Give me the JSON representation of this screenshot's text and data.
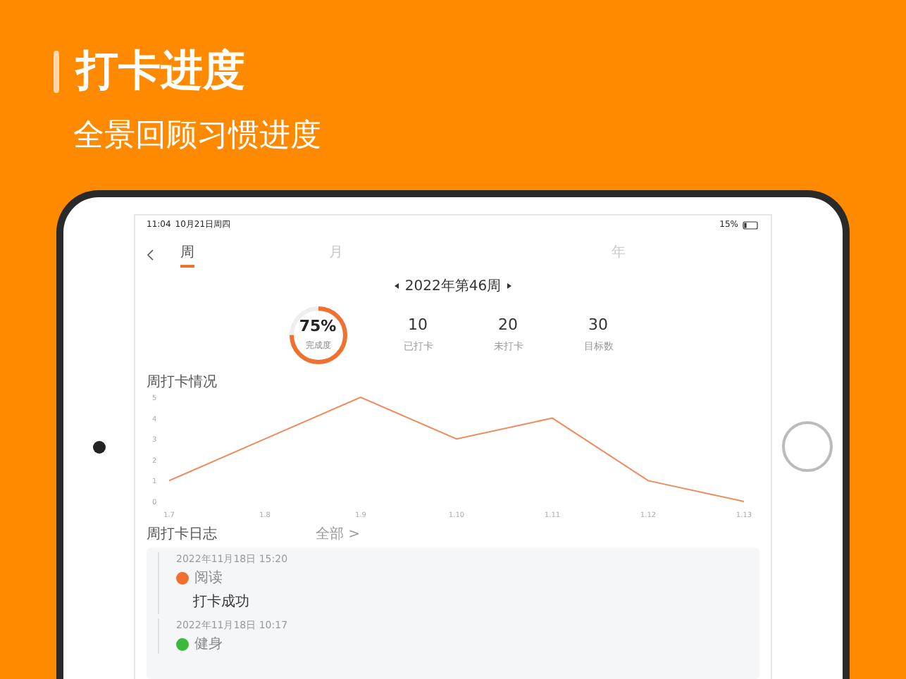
{
  "banner": {
    "title": "打卡进度",
    "subtitle": "全景回顾习惯进度"
  },
  "status_bar": {
    "time": "11:04",
    "date": "10月21日周四",
    "battery": "15%"
  },
  "tabs": [
    {
      "label": "周",
      "selected": true
    },
    {
      "label": "月",
      "selected": false
    },
    {
      "label": "年",
      "selected": false
    }
  ],
  "period": {
    "label": "2022年第46周"
  },
  "progress": {
    "value": "75%",
    "caption": "完成度",
    "level": 0.75
  },
  "stats": [
    {
      "value": "10",
      "label": "已打卡"
    },
    {
      "value": "20",
      "label": "未打卡"
    },
    {
      "value": "30",
      "label": "目标数"
    }
  ],
  "chart": {
    "title": "周打卡情况",
    "chart_data": {
      "type": "line",
      "categories": [
        "1.7",
        "1.8",
        "1.9",
        "1.10",
        "1.11",
        "1.12",
        "1.13"
      ],
      "series": [
        {
          "color": "#f08a5d",
          "values": [
            1,
            3,
            5,
            3,
            4,
            1,
            0
          ]
        }
      ],
      "ylim": [
        0,
        5
      ],
      "yticks": [
        0,
        1,
        2,
        3,
        4,
        5
      ]
    }
  },
  "log": {
    "title": "周打卡日志",
    "more": "全部 >",
    "entries": [
      {
        "time": "2022年11月18日 15:20",
        "habit": "阅读",
        "color": "#f07030",
        "message": "打卡成功"
      },
      {
        "time": "2022年11月18日 10:17",
        "habit": "健身",
        "color": "#3cb83c"
      }
    ]
  }
}
